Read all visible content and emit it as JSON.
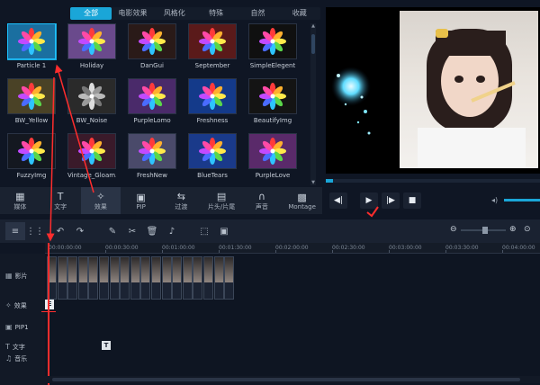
{
  "effects_panel": {
    "categories": [
      "全部",
      "电影效果",
      "风格化",
      "特殊",
      "自然",
      "收藏"
    ],
    "active_category": "全部",
    "tiles": [
      {
        "label": "Particle 1",
        "bg": "#1a6fa0"
      },
      {
        "label": "Holiday",
        "bg": "#6a4a8c"
      },
      {
        "label": "DanGui",
        "bg": "#2a1a18"
      },
      {
        "label": "September",
        "bg": "#5a1a1a"
      },
      {
        "label": "SimpleElegent",
        "bg": "#101010"
      },
      {
        "label": "BW_Yellow",
        "bg": "#4a4226"
      },
      {
        "label": "BW_Noise",
        "bg": "#2a2a2a"
      },
      {
        "label": "PurpleLomo",
        "bg": "#4a2a6a"
      },
      {
        "label": "Freshness",
        "bg": "#143a8a"
      },
      {
        "label": "BeautifyImg",
        "bg": "#141414"
      },
      {
        "label": "FuzzyImg",
        "bg": "#141820"
      },
      {
        "label": "Vintage_Gloam...",
        "bg": "#3a1a2a"
      },
      {
        "label": "FreshNew",
        "bg": "#4a4a6a"
      },
      {
        "label": "BlueTears",
        "bg": "#1a3a8a"
      },
      {
        "label": "PurpleLove",
        "bg": "#5a2a6a"
      }
    ]
  },
  "toolbar": {
    "items": [
      {
        "label": "媒体",
        "icon": "film-icon",
        "glyph": "▦"
      },
      {
        "label": "文字",
        "icon": "text-icon",
        "glyph": "T"
      },
      {
        "label": "效果",
        "icon": "magic-wand-icon",
        "glyph": "✧"
      },
      {
        "label": "PIP",
        "icon": "pip-icon",
        "glyph": "▣"
      },
      {
        "label": "过渡",
        "icon": "transition-icon",
        "glyph": "⇆"
      },
      {
        "label": "片头/片尾",
        "icon": "clapboard-icon",
        "glyph": "▤"
      },
      {
        "label": "声音",
        "icon": "headphones-icon",
        "glyph": "∩"
      },
      {
        "label": "Montage",
        "icon": "montage-icon",
        "glyph": "▩"
      }
    ],
    "active": "效果"
  },
  "timeline": {
    "ruler_ticks": [
      "00:00:00:00",
      "00:00:30:00",
      "00:01:00:00",
      "00:01:30:00",
      "00:02:00:00",
      "00:02:30:00",
      "00:03:00:00",
      "00:03:30:00",
      "00:04:00:00"
    ],
    "tracks": {
      "video_label": "影片",
      "effect_label": "效果",
      "pip_label": "PIP1",
      "text_label": "文字",
      "music_label": "音乐"
    },
    "effect_marker": "E",
    "text_marker": "T"
  },
  "colors": {
    "accent": "#1aa6d8",
    "annotation_red": "#ff2d2d",
    "background": "#0f1624"
  }
}
